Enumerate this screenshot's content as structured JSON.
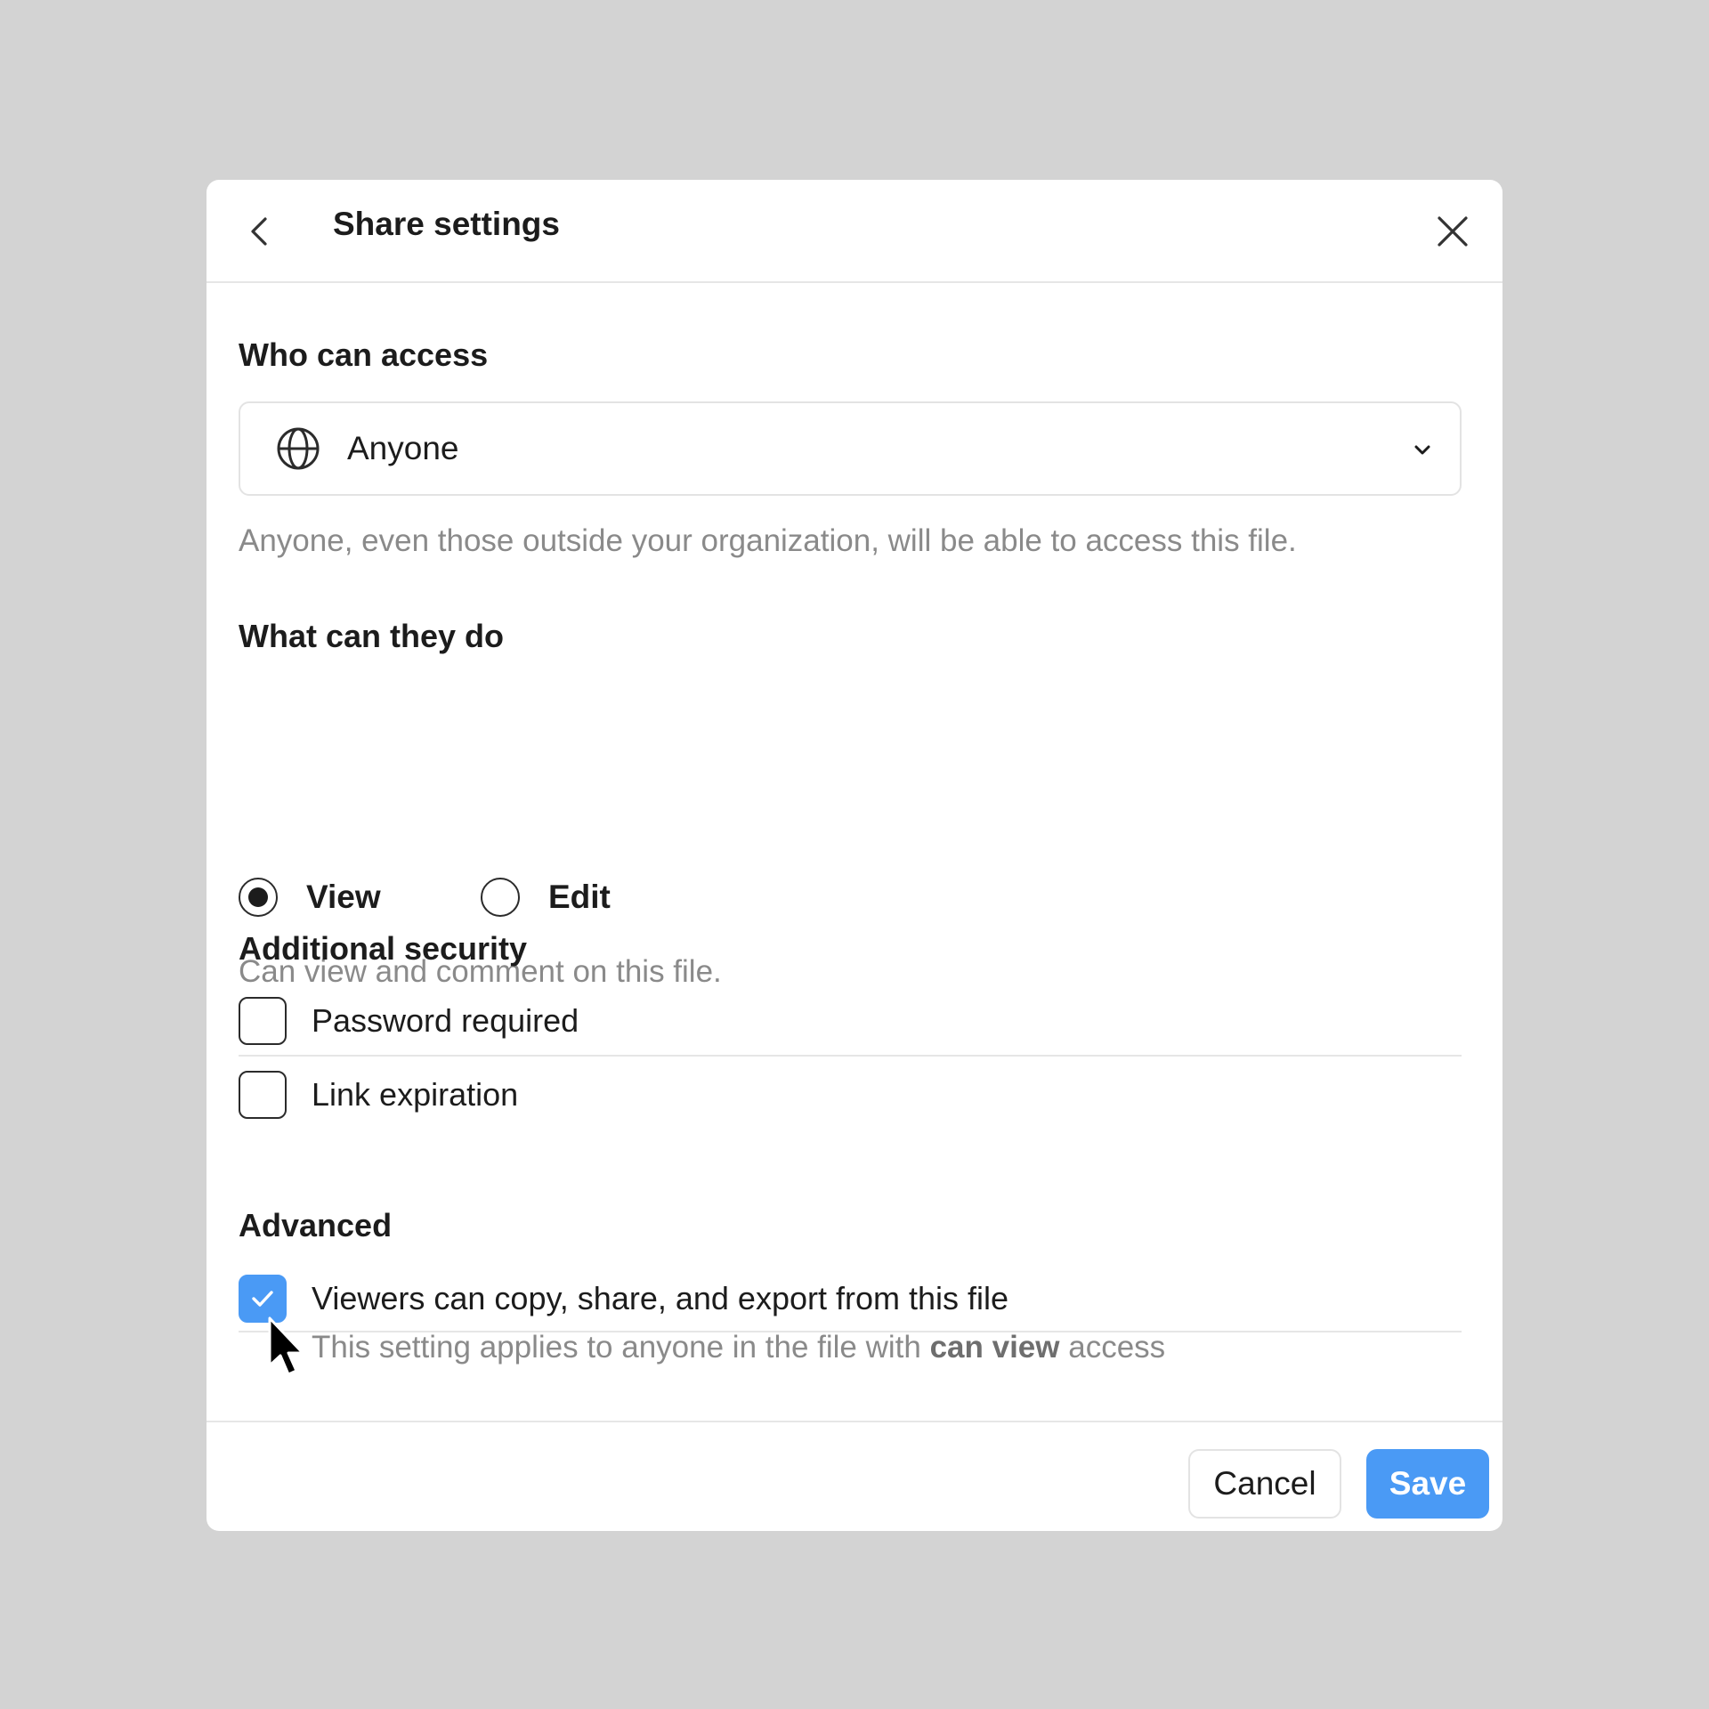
{
  "dialog": {
    "title": "Share settings",
    "back_icon": "chevron-left-icon",
    "close_icon": "close-icon"
  },
  "access": {
    "section_title": "Who can access",
    "selected_value": "Anyone",
    "icon": "globe-icon",
    "dropdown_icon": "chevron-down-icon",
    "help_text": "Anyone, even those outside your organization, will be able to access this file."
  },
  "permissions": {
    "section_title": "What can they do",
    "options": [
      {
        "label": "View",
        "selected": true
      },
      {
        "label": "Edit",
        "selected": false
      }
    ],
    "help_text": "Can view and comment on this file."
  },
  "security": {
    "section_title": "Additional security",
    "options": [
      {
        "label": "Password required",
        "checked": false
      },
      {
        "label": "Link expiration",
        "checked": false
      }
    ]
  },
  "advanced": {
    "section_title": "Advanced",
    "option_label": "Viewers can copy, share, and export from this file",
    "option_checked": true,
    "help_prefix": "This setting applies to anyone in the file with ",
    "help_bold": "can view",
    "help_suffix": " access"
  },
  "footer": {
    "cancel_label": "Cancel",
    "save_label": "Save"
  },
  "colors": {
    "accent": "#4a9af5",
    "background": "#d3d3d3",
    "muted_text": "#8a8a8a"
  }
}
